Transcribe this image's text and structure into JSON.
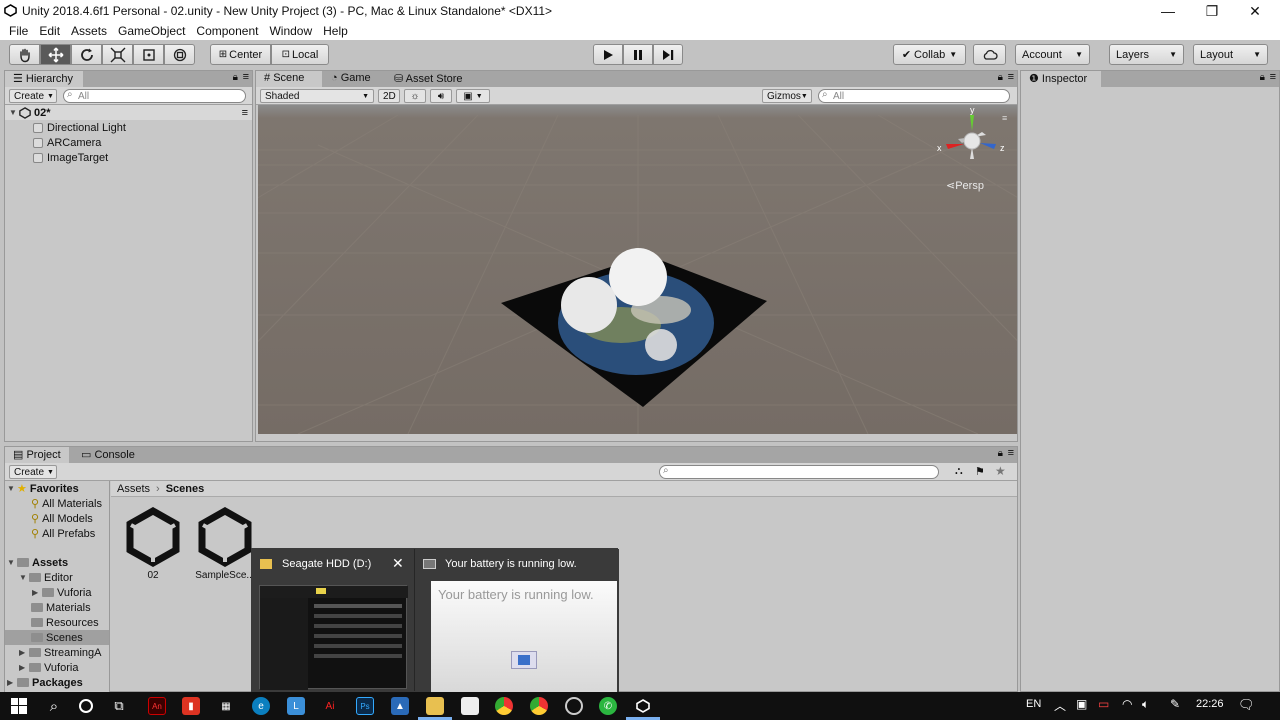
{
  "window": {
    "title": "Unity 2018.4.6f1 Personal - 02.unity - New Unity Project (3) - PC, Mac & Linux Standalone* <DX11>",
    "minimize": "—",
    "restore": "❐",
    "close": "✕"
  },
  "menu": [
    "File",
    "Edit",
    "Assets",
    "GameObject",
    "Component",
    "Window",
    "Help"
  ],
  "toolbar": {
    "pivot": "Center",
    "space": "Local",
    "collab": "Collab",
    "account": "Account",
    "layers": "Layers",
    "layout": "Layout"
  },
  "hierarchy": {
    "tab": "Hierarchy",
    "create": "Create",
    "search_placeholder": "All",
    "scene_name": "02*",
    "items": [
      "Directional Light",
      "ARCamera",
      "ImageTarget"
    ]
  },
  "scene": {
    "tabs": [
      "Scene",
      "Game",
      "Asset Store"
    ],
    "shading": "Shaded",
    "mode_2d": "2D",
    "gizmos": "Gizmos",
    "search_placeholder": "All",
    "persp": "Persp",
    "axis_x": "x",
    "axis_y": "y",
    "axis_z": "z"
  },
  "inspector": {
    "tab": "Inspector"
  },
  "project": {
    "tabs": [
      "Project",
      "Console"
    ],
    "create": "Create",
    "favorites_label": "Favorites",
    "favorites": [
      "All Materials",
      "All Models",
      "All Prefabs"
    ],
    "assets_label": "Assets",
    "tree": [
      {
        "label": "Editor",
        "indent": 1,
        "expanded": true
      },
      {
        "label": "Vuforia",
        "indent": 2,
        "expanded": false
      },
      {
        "label": "Materials",
        "indent": 1
      },
      {
        "label": "Resources",
        "indent": 1
      },
      {
        "label": "Scenes",
        "indent": 1,
        "selected": true
      },
      {
        "label": "StreamingA",
        "indent": 1,
        "expanded": false
      },
      {
        "label": "Vuforia",
        "indent": 1,
        "expanded": false
      }
    ],
    "packages_label": "Packages",
    "breadcrumb": [
      "Assets",
      "Scenes"
    ],
    "files": [
      "02",
      "SampleSce..."
    ]
  },
  "popups": {
    "thumb1_title": "Seagate HDD (D:)",
    "thumb2_title": "Your battery is running low.",
    "thumb2_body": "Your battery is running low."
  },
  "taskbar": {
    "lang": "EN",
    "time": "22:26"
  },
  "colors": {
    "unity_panel": "#c8c8c8",
    "taskbar": "#101010",
    "axis_x": "#d22",
    "axis_y": "#6c3",
    "axis_z": "#36c"
  }
}
